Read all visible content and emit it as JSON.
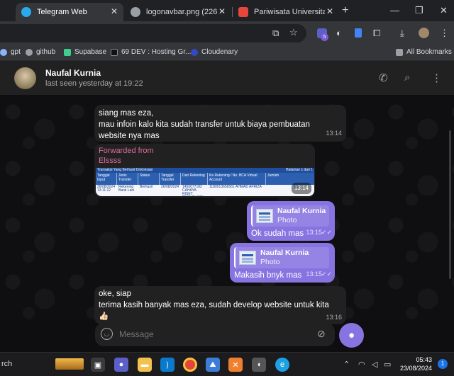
{
  "tabs": [
    {
      "title": "Telegram Web",
      "active": true
    },
    {
      "title": "logonavbar.png (226×22",
      "active": false
    },
    {
      "title": "Pariwisata Universitas Pa",
      "active": false
    }
  ],
  "window_controls": {
    "minimize": "—",
    "maximize": "❐",
    "close": "✕"
  },
  "bookmarks": [
    {
      "label": "gpt",
      "color": "#8ab4f8"
    },
    {
      "label": "github",
      "color": "#9aa0a6"
    },
    {
      "label": "Supabase",
      "color": "#3ecf8e"
    },
    {
      "label": "69 DEV : Hosting Gr...",
      "color": "#111111"
    },
    {
      "label": "Cloudenary",
      "color": "#3448c5"
    }
  ],
  "all_bookmarks_label": "All Bookmarks",
  "extension_badge": "5",
  "chat": {
    "name": "Naufal Kurnia",
    "status": "last seen yesterday at 19:22"
  },
  "messages": {
    "m1": {
      "text_lines": [
        "siang mas eza,",
        "mau infoin kalo kita sudah transfer untuk biaya pembuatan",
        "website nya mas"
      ],
      "time": "13:14"
    },
    "m2": {
      "forwarded_label": "Forwarded from",
      "forwarded_name": "Elssss",
      "time": "13:14"
    },
    "m3": {
      "reply_name": "Naufal Kurnia",
      "reply_sub": "Photo",
      "text": "Ok sudah mas",
      "time": "13:15"
    },
    "m4": {
      "reply_name": "Naufal Kurnia",
      "reply_sub": "Photo",
      "text": "Makasih bnyk mas",
      "time": "13:15"
    },
    "m5": {
      "text_lines": [
        "oke, siap",
        "terima kasih banyak mas eza, sudah develop website untuk kita",
        "👍🏻"
      ],
      "time": "13:16"
    }
  },
  "receipt": {
    "title": "Transaksi Yang Berhasil Diotorisasi",
    "page": "Halaman 1 dari 1",
    "columns": [
      "Tanggal Input",
      "Jenis Transfer",
      "Status",
      "Tanggal Transfer",
      "Dari Rekening",
      "Ke Rekening / No. BCA Virtual Account",
      "Jumlah"
    ],
    "row": [
      "26/08/2024 13:11:22",
      "Rekening Bank Lain",
      "Berhasil",
      "26/08/2024",
      "1450077182 CAHAYA RISET TEKNOLOGI C",
      "1180013656561 AHMAD AFRIZA",
      "Rp"
    ]
  },
  "composer": {
    "placeholder": "Message"
  },
  "taskbar": {
    "search_fragment": "rch",
    "time": "05:43",
    "date": "23/08/2024",
    "notification_count": "1"
  }
}
